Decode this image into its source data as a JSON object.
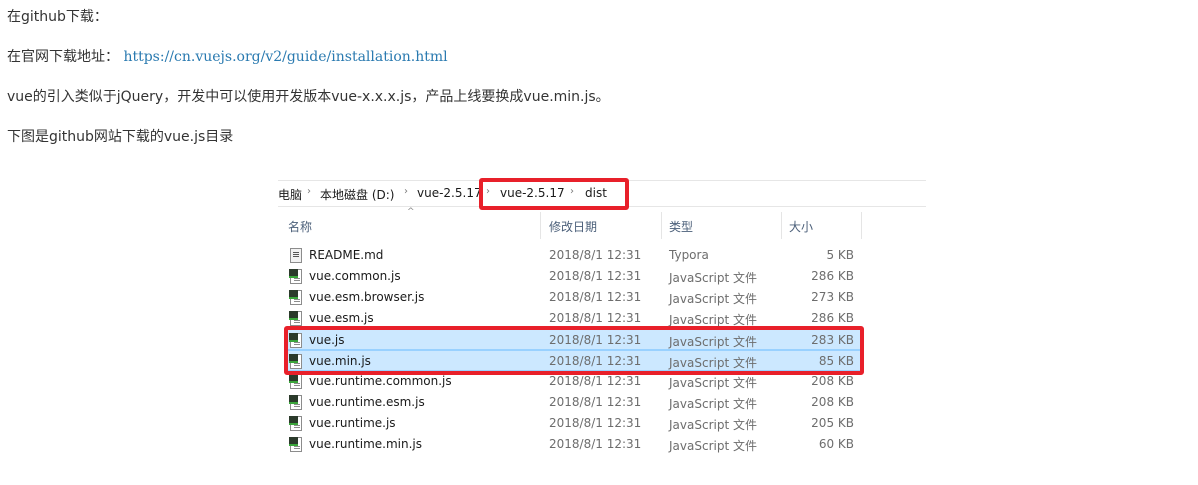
{
  "article": {
    "line1": "在github下载：",
    "line2_prefix": "在官网下载地址：",
    "line2_link": "https://cn.vuejs.org/v2/guide/installation.html",
    "line3": "vue的引入类似于jQuery，开发中可以使用开发版本vue-x.x.x.js，产品上线要换成vue.min.js。",
    "line4": "下图是github网站下载的vue.js目录"
  },
  "explorer": {
    "breadcrumb": [
      "电脑",
      "本地磁盘 (D:)",
      "vue-2.5.17",
      "vue-2.5.17",
      "dist"
    ],
    "columns": {
      "name": "名称",
      "date": "修改日期",
      "type": "类型",
      "size": "大小"
    },
    "files": [
      {
        "name": "README.md",
        "date": "2018/8/1 12:31",
        "type": "Typora",
        "size": "5 KB",
        "icon": "markdown-file-icon",
        "selected": false
      },
      {
        "name": "vue.common.js",
        "date": "2018/8/1 12:31",
        "type": "JavaScript 文件",
        "size": "286 KB",
        "icon": "js-file-icon",
        "selected": false
      },
      {
        "name": "vue.esm.browser.js",
        "date": "2018/8/1 12:31",
        "type": "JavaScript 文件",
        "size": "273 KB",
        "icon": "js-file-icon",
        "selected": false
      },
      {
        "name": "vue.esm.js",
        "date": "2018/8/1 12:31",
        "type": "JavaScript 文件",
        "size": "286 KB",
        "icon": "js-file-icon",
        "selected": false
      },
      {
        "name": "vue.js",
        "date": "2018/8/1 12:31",
        "type": "JavaScript 文件",
        "size": "283 KB",
        "icon": "js-file-icon",
        "selected": true
      },
      {
        "name": "vue.min.js",
        "date": "2018/8/1 12:31",
        "type": "JavaScript 文件",
        "size": "85 KB",
        "icon": "js-file-icon",
        "selected": true
      },
      {
        "name": "vue.runtime.common.js",
        "date": "2018/8/1 12:31",
        "type": "JavaScript 文件",
        "size": "208 KB",
        "icon": "js-file-icon",
        "selected": false
      },
      {
        "name": "vue.runtime.esm.js",
        "date": "2018/8/1 12:31",
        "type": "JavaScript 文件",
        "size": "208 KB",
        "icon": "js-file-icon",
        "selected": false
      },
      {
        "name": "vue.runtime.js",
        "date": "2018/8/1 12:31",
        "type": "JavaScript 文件",
        "size": "205 KB",
        "icon": "js-file-icon",
        "selected": false
      },
      {
        "name": "vue.runtime.min.js",
        "date": "2018/8/1 12:31",
        "type": "JavaScript 文件",
        "size": "60 KB",
        "icon": "js-file-icon",
        "selected": false
      }
    ]
  },
  "colors": {
    "link": "#2a7ab0",
    "selection": "#cce8ff",
    "annotation_box": "#e8202a"
  }
}
